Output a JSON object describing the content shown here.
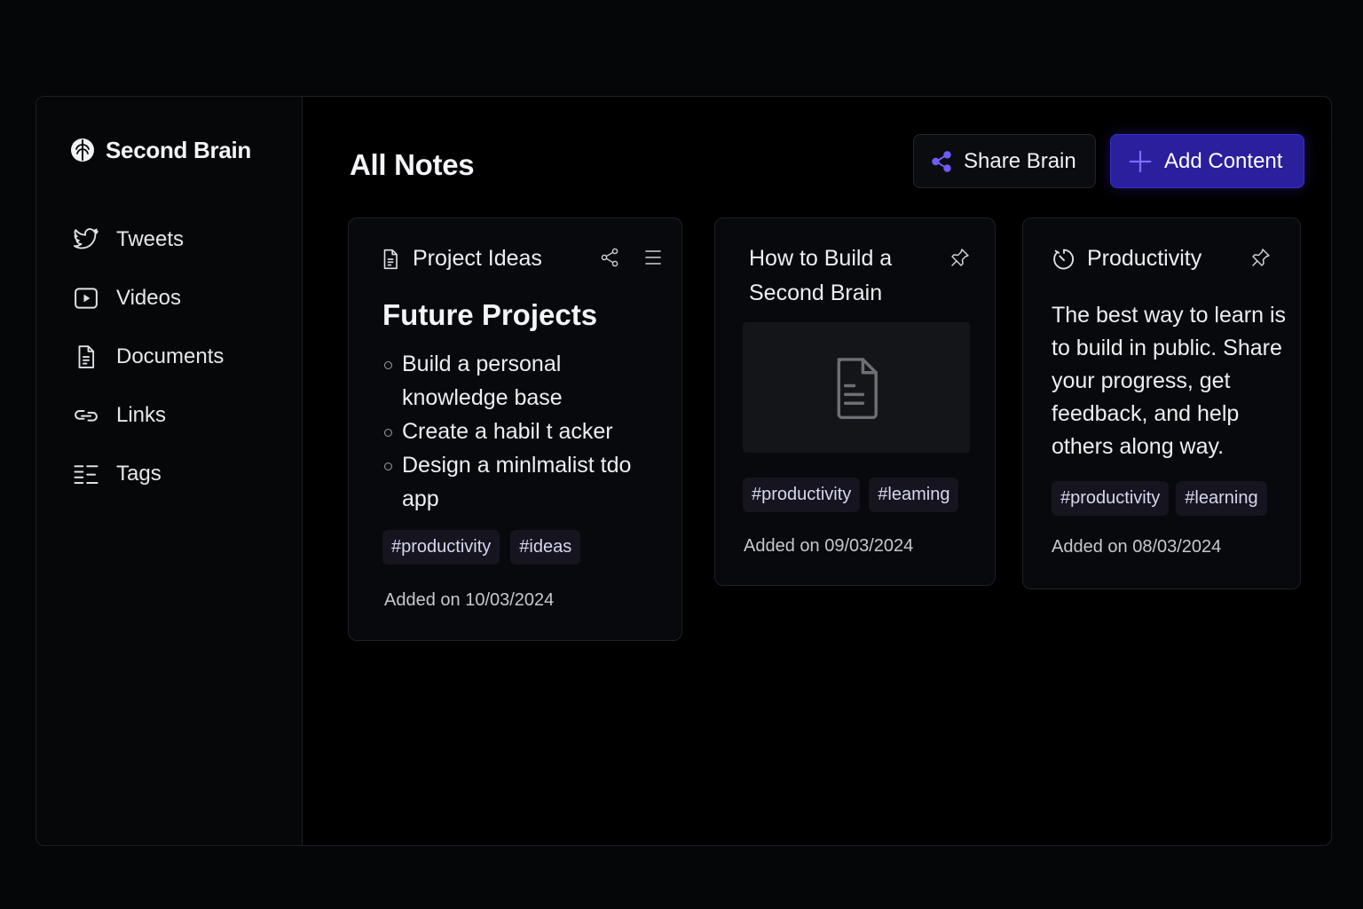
{
  "sidebar": {
    "brand": "Second Brain",
    "items": [
      {
        "label": "Tweets",
        "icon": "twitter-icon"
      },
      {
        "label": "Videos",
        "icon": "video-icon"
      },
      {
        "label": "Documents",
        "icon": "document-icon"
      },
      {
        "label": "Links",
        "icon": "link-icon"
      },
      {
        "label": "Tags",
        "icon": "tags-icon"
      }
    ]
  },
  "header": {
    "title": "All Notes",
    "share_label": "Share Brain",
    "add_label": "Add Content"
  },
  "colors": {
    "accent": "#2a1f9c",
    "accent_icon": "#6e5bff",
    "background": "#000000"
  },
  "cards": [
    {
      "title": "Project Ideas",
      "heading": "Future Projects",
      "bullets": [
        "Build a personal knowledge base",
        "Create a habil t acker",
        "Design a minlmalist tdo app"
      ],
      "tags": [
        "#productivity",
        "#ideas"
      ],
      "date": "Added on 10/03/2024"
    },
    {
      "title": "How to Build a Second Brain",
      "tags": [
        "#productivity",
        "#leaming"
      ],
      "date": "Added on 09/03/2024"
    },
    {
      "title": "Productivity",
      "body": "The best way to learn is to build in public. Share your progress, get feedback, and help others along way.",
      "tags": [
        "#productivity",
        "#learning"
      ],
      "date": "Added on 08/03/2024"
    }
  ]
}
